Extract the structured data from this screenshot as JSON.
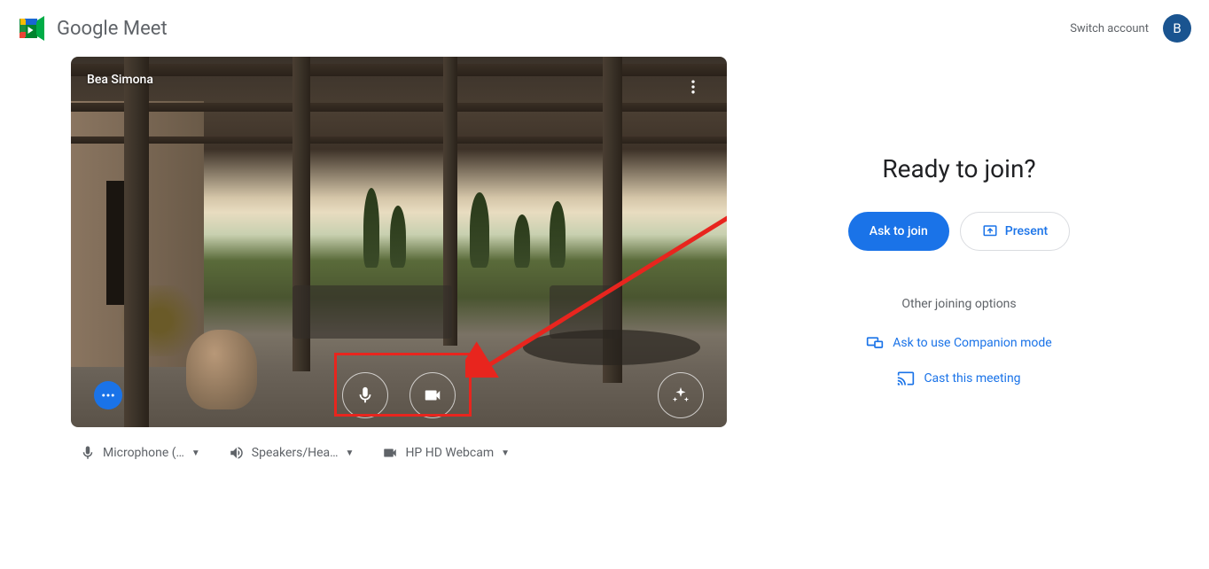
{
  "header": {
    "brand_google": "Google",
    "brand_meet": "Meet",
    "switch_account": "Switch account",
    "avatar_letter": "B"
  },
  "preview": {
    "user_name": "Bea Simona"
  },
  "devices": {
    "microphone": "Microphone (…",
    "speakers": "Speakers/Hea…",
    "camera": "HP HD Webcam"
  },
  "join": {
    "title": "Ready to join?",
    "ask_to_join": "Ask to join",
    "present": "Present",
    "other_options": "Other joining options",
    "companion_mode": "Ask to use Companion mode",
    "cast_meeting": "Cast this meeting"
  }
}
